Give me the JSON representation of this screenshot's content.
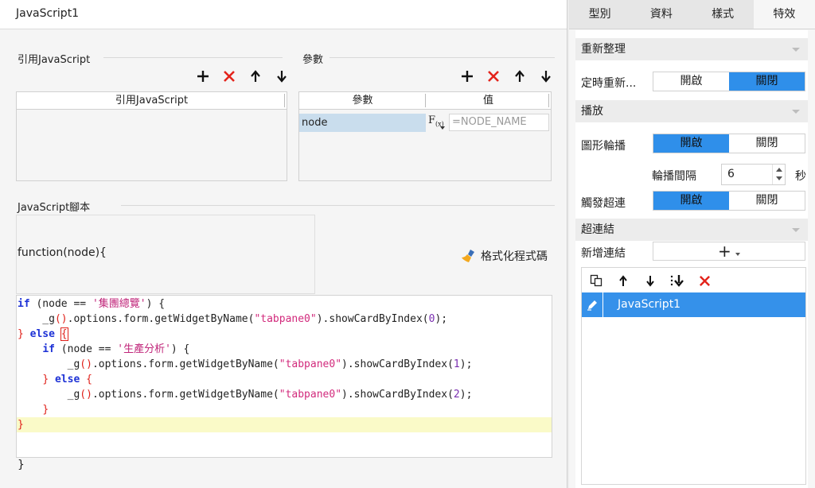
{
  "dialog": {
    "title": "JavaScript1",
    "cited_section_label": "引用JavaScript",
    "cited_column_header": "引用JavaScript",
    "params_section_label": "參數",
    "params_col_param": "參數",
    "params_col_value": "值",
    "params": [
      {
        "name": "node",
        "fx_label": "F",
        "fx_sub": "(x)",
        "value_placeholder": "=NODE_NAME"
      }
    ],
    "script_section_label": "JavaScript腳本",
    "function_head": "function(node){",
    "format_button_label": "格式化程式碼",
    "function_tail": "}",
    "toolbar_icons": [
      "add-icon",
      "delete-icon",
      "move-up-icon",
      "move-down-icon"
    ]
  },
  "code": {
    "line1": {
      "kw": "if",
      "p1": " (node == ",
      "s": "'集團總覽'",
      "p2": ") {"
    },
    "line2": {
      "indent": "    _g",
      "paren": "()",
      "mid": ".options.form.getWidgetByName(",
      "s": "\"tabpane0\"",
      "mid2": ").showCardByIndex(",
      "n": "0",
      "end": ");"
    },
    "line3": {
      "brace": "}",
      "kw": " else ",
      "brace2": "{"
    },
    "line4": {
      "indent": "    ",
      "kw": "if",
      "p1": " (node == ",
      "s": "'生產分析'",
      "p2": ") {"
    },
    "line5": {
      "indent": "        _g",
      "paren": "()",
      "mid": ".options.form.getWidgetByName(",
      "s": "\"tabpane0\"",
      "mid2": ").showCardByIndex(",
      "n": "1",
      "end": ");"
    },
    "line6": {
      "indent": "    ",
      "brace": "}",
      "kw": " else ",
      "brace2": "{"
    },
    "line7": {
      "indent": "        _g",
      "paren": "()",
      "mid": ".options.form.getWidgetByName(",
      "s": "\"tabpane0\"",
      "mid2": ").showCardByIndex(",
      "n": "2",
      "end": ");"
    },
    "line8": {
      "indent": "    ",
      "brace": "}"
    },
    "line9": {
      "brace": "}"
    }
  },
  "right_panel": {
    "tabs": [
      "型別",
      "資料",
      "樣式",
      "特效"
    ],
    "active_tab": "特效",
    "refresh_group": "重新整理",
    "timed_refresh_label": "定時重新...",
    "play_group": "播放",
    "carousel_label": "圖形輪播",
    "interval_label": "輪播間隔",
    "interval_value": "6",
    "interval_unit": "秒",
    "trigger_link_label": "觸發超連",
    "hyperlink_group": "超連結",
    "add_link_label": "新增連結",
    "add_link_button": "+",
    "on_label": "開啟",
    "off_label": "關閉",
    "link_items": [
      "JavaScript1"
    ],
    "accent_color": "#2f8fea"
  }
}
